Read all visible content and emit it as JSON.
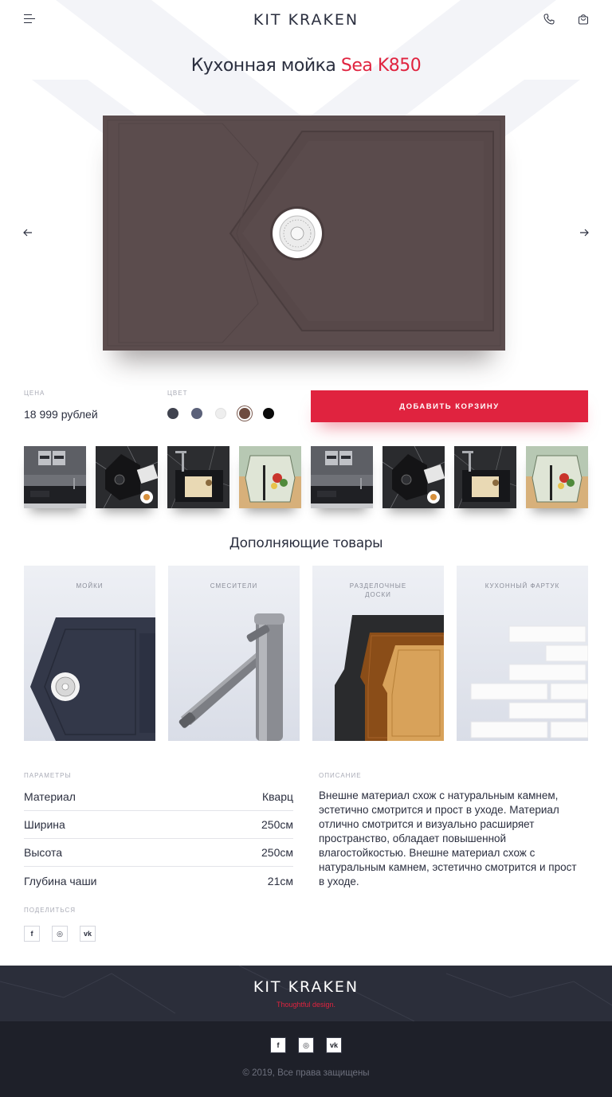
{
  "header": {
    "logo": "KIT KRAKEN",
    "menu_icon": "hamburger-icon",
    "phone_icon": "phone-icon",
    "cart_icon": "cart-icon"
  },
  "title": {
    "prefix": "Кухонная мойка",
    "accent": "Sea K850"
  },
  "product": {
    "image": "sink-sea-k850-image",
    "prev_icon": "arrow-left-icon",
    "next_icon": "arrow-right-icon"
  },
  "price": {
    "label": "ЦЕНА",
    "value": "18 999 рублей"
  },
  "color": {
    "label": "ЦВЕТ",
    "swatches": [
      "#3f424e",
      "#5b6179",
      "#eeeeee",
      "#6e4c40",
      "#0a0a0a"
    ],
    "selected_index": 3
  },
  "add_to_cart": "ДОБАВИТЬ КОРЗИНУ",
  "colors": {
    "accent": "#e0233f",
    "text": "#2b2f3f",
    "sink": "#5b4c4d"
  },
  "thumbnails": [
    "kitchen-interior",
    "sink-black-marble",
    "sink-with-board",
    "cutting-board-vegetables",
    "kitchen-interior",
    "sink-black-marble",
    "sink-with-board",
    "cutting-board-vegetables"
  ],
  "complementary": {
    "title": "Дополняющие товары",
    "cards": [
      {
        "label": "МОЙКИ"
      },
      {
        "label": "СМЕСИТЕЛИ"
      },
      {
        "label": "РАЗДЕЛОЧНЫЕ ДОСКИ"
      },
      {
        "label": "КУХОННЫЙ ФАРТУК"
      }
    ]
  },
  "parameters": {
    "label": "ПАРАМЕТРЫ",
    "rows": [
      {
        "name": "Материал",
        "value": "Кварц"
      },
      {
        "name": "Ширина",
        "value": "250см"
      },
      {
        "name": "Высота",
        "value": "250см"
      },
      {
        "name": "Глубина чаши",
        "value": "21см"
      }
    ]
  },
  "description": {
    "label": "ОПИСАНИЕ",
    "text": "Внешне материал схож с натуральным камнем, эстетично смотрится и прост в уходе. Материал отлично смотрится и визуально расширяет пространство, обладает повышенной влагостойкостью. Внешне материал схож с натуральным камнем, эстетично смотрится и прост в уходе."
  },
  "share": {
    "label": "ПОДЕЛИТЬСЯ",
    "icons": [
      "f",
      "◎",
      "vk"
    ]
  },
  "footer": {
    "logo": "KIT KRAKEN",
    "tagline": "Thoughtful design.",
    "icons": [
      "f",
      "◎",
      "vk"
    ],
    "copyright": "© 2019, Все права защищены"
  }
}
